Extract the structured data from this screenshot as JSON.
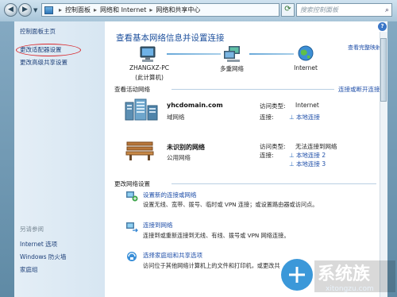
{
  "address_bar": {
    "crumbs": [
      "控制面板",
      "网络和 Internet",
      "网络和共享中心"
    ],
    "search_placeholder": "搜索控制面板"
  },
  "left_pane": {
    "home": "控制面板主页",
    "change_adapter": "更改适配器设置",
    "advanced_sharing": "更改高级共享设置",
    "see_also": "另请参阅",
    "internet_options": "Internet 选项",
    "firewall": "Windows 防火墙",
    "homegroup": "家庭组"
  },
  "main": {
    "title": "查看基本网络信息并设置连接",
    "full_map": "查看完整映射",
    "map": {
      "pc_name": "ZHANGXZ-PC",
      "pc_sub": "(此计算机)",
      "multi": "多重网络",
      "internet": "Internet"
    },
    "active_heading": "查看活动网络",
    "connect_disconnect": "连接或断开连接",
    "networks": [
      {
        "name": "yhcdomain.com",
        "type": "域网络",
        "access_label": "访问类型:",
        "access_value": "Internet",
        "conn_label": "连接:",
        "connections": [
          "本地连接"
        ]
      },
      {
        "name": "未识别的网络",
        "type": "公用网络",
        "access_label": "访问类型:",
        "access_value": "无法连接到网络",
        "conn_label": "连接:",
        "connections": [
          "本地连接 2",
          "本地连接 3"
        ]
      }
    ],
    "change_heading": "更改网络设置",
    "tasks": [
      {
        "title": "设置新的连接或网络",
        "desc": "设置无线、宽带、拨号、临时或 VPN 连接；或设置路由器或访问点。"
      },
      {
        "title": "连接到网络",
        "desc": "连接到或重新连接到无线、有线、拨号或 VPN 网络连接。"
      },
      {
        "title": "选择家庭组和共享选项",
        "desc": "访问位于其他网络计算机上的文件和打印机，或更改共"
      }
    ]
  },
  "watermark": {
    "text": "系统族",
    "url": "xitongzu.com"
  }
}
